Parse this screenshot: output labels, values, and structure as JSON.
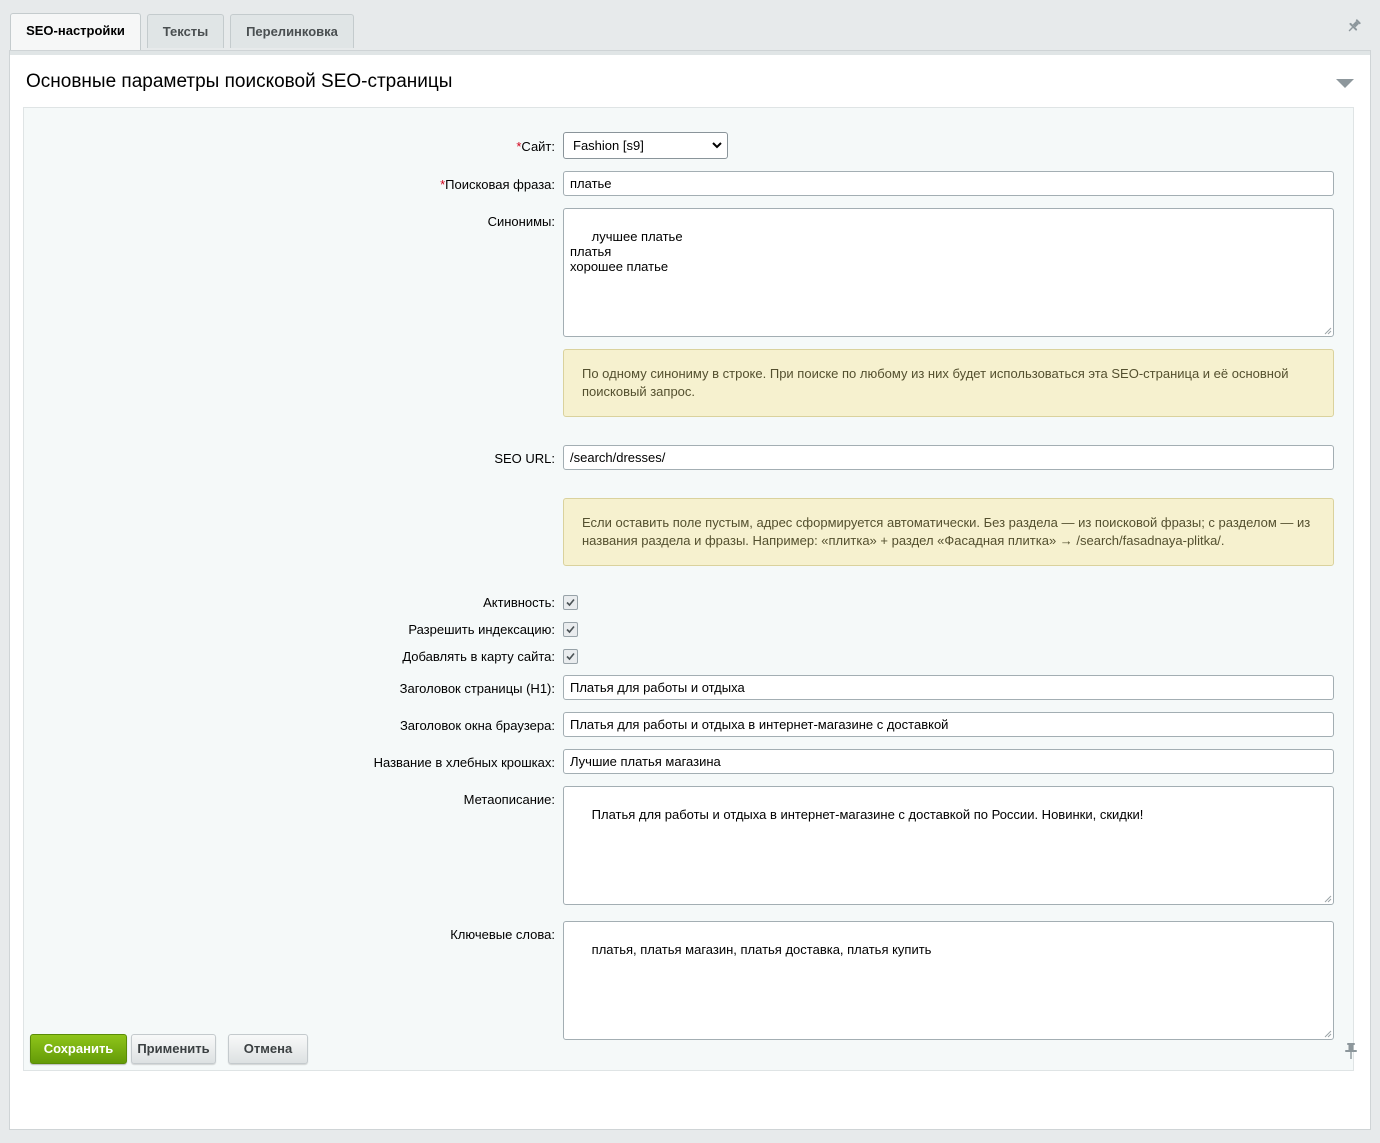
{
  "tabs": [
    {
      "label": "SEO-настройки",
      "active": true
    },
    {
      "label": "Тексты",
      "active": false
    },
    {
      "label": "Перелинковка",
      "active": false
    }
  ],
  "section": {
    "title": "Основные параметры поисковой SEO-страницы"
  },
  "form": {
    "required_mark": "*",
    "site": {
      "label": "Сайт:",
      "value": "Fashion [s9]"
    },
    "search_phrase": {
      "label": "Поисковая фраза:",
      "value": "платье"
    },
    "synonyms": {
      "label": "Синонимы:",
      "value": "лучшее платье\nплатья\nхорошее платье"
    },
    "synonyms_hint": "По одному синониму в строке. При поиске по любому из них будет использоваться эта SEO-страница и её основной поисковый запрос.",
    "seo_url": {
      "label": "SEO URL:",
      "value": "/search/dresses/"
    },
    "seo_url_hint": "Если оставить поле пустым, адрес сформируется автоматически. Без раздела — из поисковой фразы; с разделом — из названия раздела и фразы. Например: «плитка» + раздел «Фасадная плитка» → /search/fasadnaya-plitka/.",
    "active": {
      "label": "Активность:",
      "checked": true
    },
    "allow_indexing": {
      "label": "Разрешить индексацию:",
      "checked": true
    },
    "add_to_sitemap": {
      "label": "Добавлять в карту сайта:",
      "checked": true
    },
    "h1": {
      "label": "Заголовок страницы (H1):",
      "value": "Платья для работы и отдыха"
    },
    "browser_title": {
      "label": "Заголовок окна браузера:",
      "value": "Платья для работы и отдыха в интернет-магазине с доставкой"
    },
    "breadcrumb_name": {
      "label": "Название в хлебных крошках:",
      "value": "Лучшие платья магазина"
    },
    "meta_description": {
      "label": "Метаописание:",
      "value": "Платья для работы и отдыха в интернет-магазине с доставкой по России. Новинки, скидки!"
    },
    "keywords": {
      "label": "Ключевые слова:",
      "value": "платья, платья магазин, платья доставка, платья купить"
    }
  },
  "buttons": {
    "save": "Сохранить",
    "apply": "Применить",
    "cancel": "Отмена"
  },
  "colors": {
    "save_button": "#74ad0d",
    "hint_background": "#f6f1cf",
    "required": "#d1001a"
  }
}
